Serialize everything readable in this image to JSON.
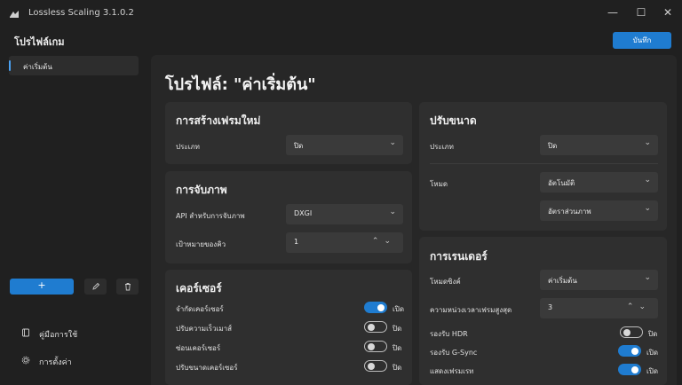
{
  "window": {
    "title": "Lossless Scaling 3.1.0.2",
    "controls": {
      "minimize": "—",
      "maximize": "☐",
      "close": "✕"
    }
  },
  "header": {
    "title": "โปรไฟล์เกม",
    "save_label": "บันทึก"
  },
  "sidebar": {
    "profiles": [
      {
        "label": "ค่าเริ่มต้น",
        "selected": true
      }
    ],
    "add_label": "+",
    "edit_icon": "pencil-icon",
    "delete_icon": "trash-icon",
    "links": [
      {
        "label": "คู่มือการใช้",
        "icon": "book-icon"
      },
      {
        "label": "การตั้งค่า",
        "icon": "gear-icon"
      }
    ]
  },
  "main": {
    "page_title": "โปรไฟล์: \"ค่าเริ่มต้น\"",
    "frame_gen": {
      "title": "การสร้างเฟรมใหม่",
      "type_label": "ประเภท",
      "type_value": "ปิด"
    },
    "capture": {
      "title": "การจับภาพ",
      "api_label": "API สำหรับการจับภาพ",
      "api_value": "DXGI",
      "queue_label": "เป้าหมายของคิว",
      "queue_value": "1"
    },
    "cursor": {
      "title": "เคอร์เซอร์",
      "items": [
        {
          "label": "จำกัดเคอร์เซอร์",
          "state": "เปิด",
          "on": true
        },
        {
          "label": "ปรับความเร็วเมาส์",
          "state": "ปิด",
          "on": false
        },
        {
          "label": "ซ่อนเคอร์เซอร์",
          "state": "ปิด",
          "on": false
        },
        {
          "label": "ปรับขนาดเคอร์เซอร์",
          "state": "ปิด",
          "on": false
        }
      ]
    },
    "scaling": {
      "title": "ปรับขนาด",
      "type_label": "ประเภท",
      "type_value": "ปิด",
      "mode_label": "โหมด",
      "mode_value": "อัตโนมัติ",
      "aspect_value": "อัตราส่วนภาพ"
    },
    "rendering": {
      "title": "การเรนเดอร์",
      "sync_label": "โหมดซิงค์",
      "sync_value": "ค่าเริ่มต้น",
      "latency_label": "ความหน่วงเวลาเฟรมสูงสุด",
      "latency_value": "3",
      "toggles": [
        {
          "label": "รองรับ HDR",
          "state": "ปิด",
          "on": false
        },
        {
          "label": "รองรับ G-Sync",
          "state": "เปิด",
          "on": true
        },
        {
          "label": "แสดงเฟรมเรท",
          "state": "เปิด",
          "on": true
        }
      ]
    }
  },
  "colors": {
    "accent": "#1f7cd0",
    "background": "#202020",
    "card": "#2f2f2f"
  }
}
